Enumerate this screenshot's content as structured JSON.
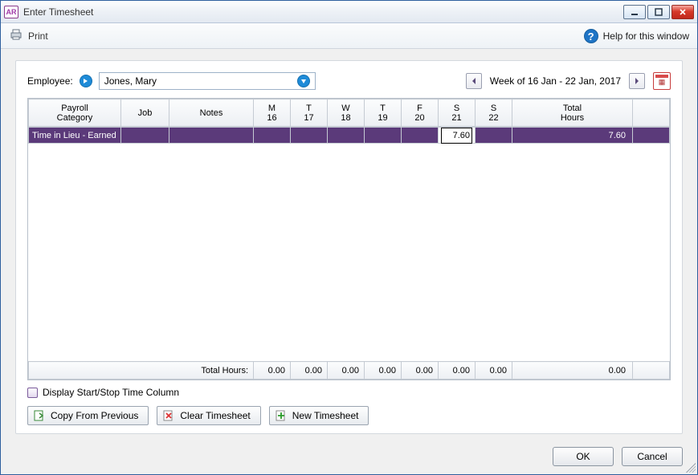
{
  "window": {
    "title": "Enter Timesheet"
  },
  "toolbar": {
    "print": "Print",
    "help": "Help for this window"
  },
  "employee": {
    "label": "Employee:",
    "value": "Jones, Mary"
  },
  "week": {
    "text": "Week of 16 Jan - 22 Jan, 2017"
  },
  "headers": {
    "payroll": "Payroll\nCategory",
    "job": "Job",
    "notes": "Notes",
    "days": [
      {
        "d": "M",
        "n": "16"
      },
      {
        "d": "T",
        "n": "17"
      },
      {
        "d": "W",
        "n": "18"
      },
      {
        "d": "T",
        "n": "19"
      },
      {
        "d": "F",
        "n": "20"
      },
      {
        "d": "S",
        "n": "21"
      },
      {
        "d": "S",
        "n": "22"
      }
    ],
    "total": "Total\nHours"
  },
  "row": {
    "category": "Time in Lieu - Earned",
    "sat_value": "7.60",
    "total": "7.60"
  },
  "footer": {
    "label": "Total Hours:",
    "v": [
      "0.00",
      "0.00",
      "0.00",
      "0.00",
      "0.00",
      "0.00",
      "0.00"
    ],
    "total": "0.00"
  },
  "options": {
    "display_startstop": "Display Start/Stop Time Column"
  },
  "buttons": {
    "copy": "Copy From Previous",
    "clear": "Clear Timesheet",
    "new": "New Timesheet",
    "ok": "OK",
    "cancel": "Cancel"
  }
}
